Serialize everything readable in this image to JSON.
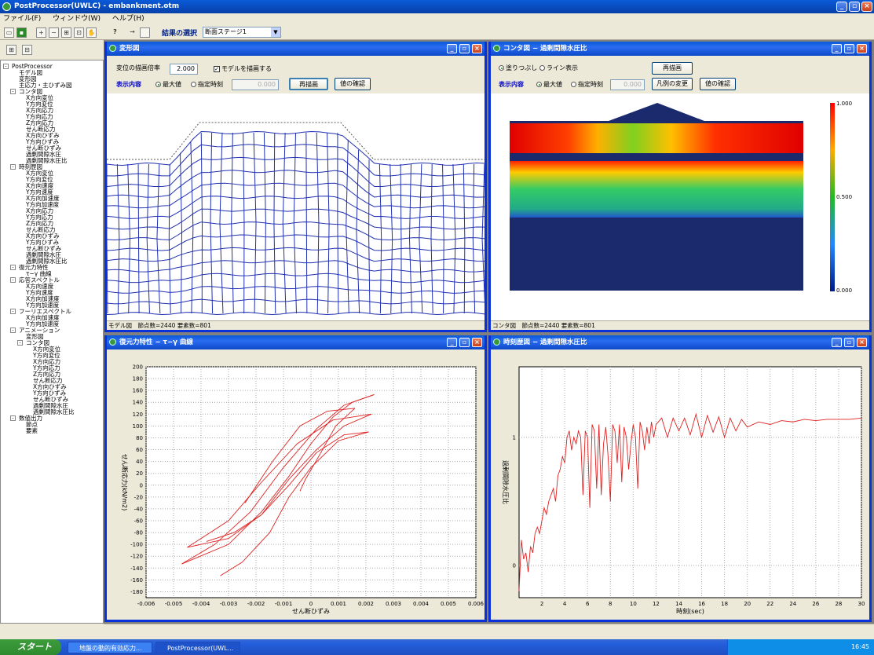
{
  "app": {
    "title": "PostProcessor(UWLC) - embankment.otm"
  },
  "menu": {
    "items": [
      "ファイル(F)",
      "ウィンドウ(W)",
      "ヘルプ(H)"
    ]
  },
  "toolbar": {
    "stage_label": "結果の選択",
    "stage_value": "断面ステージ1"
  },
  "tree": {
    "nodes": [
      {
        "label": "PostProcessor",
        "level": 0,
        "box": "-"
      },
      {
        "label": "モデル図",
        "level": 1
      },
      {
        "label": "変形図",
        "level": 1
      },
      {
        "label": "主応力・主ひずみ図",
        "level": 1
      },
      {
        "label": "コンタ図",
        "level": 1,
        "box": "-"
      },
      {
        "label": "X方向変位",
        "level": 2
      },
      {
        "label": "Y方向変位",
        "level": 2
      },
      {
        "label": "X方向応力",
        "level": 2
      },
      {
        "label": "Y方向応力",
        "level": 2
      },
      {
        "label": "Z方向応力",
        "level": 2
      },
      {
        "label": "せん断応力",
        "level": 2
      },
      {
        "label": "X方向ひずみ",
        "level": 2
      },
      {
        "label": "Y方向ひずみ",
        "level": 2
      },
      {
        "label": "せん断ひずみ",
        "level": 2
      },
      {
        "label": "過剰間隙水圧",
        "level": 2
      },
      {
        "label": "過剰間隙水圧比",
        "level": 2
      },
      {
        "label": "時刻歴図",
        "level": 1,
        "box": "-"
      },
      {
        "label": "X方向変位",
        "level": 2
      },
      {
        "label": "Y方向変位",
        "level": 2
      },
      {
        "label": "X方向速度",
        "level": 2
      },
      {
        "label": "Y方向速度",
        "level": 2
      },
      {
        "label": "X方向加速度",
        "level": 2
      },
      {
        "label": "Y方向加速度",
        "level": 2
      },
      {
        "label": "X方向応力",
        "level": 2
      },
      {
        "label": "Y方向応力",
        "level": 2
      },
      {
        "label": "Z方向応力",
        "level": 2
      },
      {
        "label": "せん断応力",
        "level": 2
      },
      {
        "label": "X方向ひずみ",
        "level": 2
      },
      {
        "label": "Y方向ひずみ",
        "level": 2
      },
      {
        "label": "せん断ひずみ",
        "level": 2
      },
      {
        "label": "過剰間隙水圧",
        "level": 2
      },
      {
        "label": "過剰間隙水圧比",
        "level": 2
      },
      {
        "label": "復元力特性",
        "level": 1,
        "box": "-"
      },
      {
        "label": "τ−γ 曲線",
        "level": 2
      },
      {
        "label": "応答スペクトル",
        "level": 1,
        "box": "-"
      },
      {
        "label": "X方向速度",
        "level": 2
      },
      {
        "label": "Y方向速度",
        "level": 2
      },
      {
        "label": "X方向加速度",
        "level": 2
      },
      {
        "label": "Y方向加速度",
        "level": 2
      },
      {
        "label": "フーリエスペクトル",
        "level": 1,
        "box": "-"
      },
      {
        "label": "X方向加速度",
        "level": 2
      },
      {
        "label": "Y方向加速度",
        "level": 2
      },
      {
        "label": "アニメーション",
        "level": 1,
        "box": "-"
      },
      {
        "label": "変形図",
        "level": 2
      },
      {
        "label": "コンタ図",
        "level": 2,
        "box": "-"
      },
      {
        "label": "X方向変位",
        "level": 3
      },
      {
        "label": "Y方向変位",
        "level": 3
      },
      {
        "label": "X方向応力",
        "level": 3
      },
      {
        "label": "Y方向応力",
        "level": 3
      },
      {
        "label": "Z方向応力",
        "level": 3
      },
      {
        "label": "せん断応力",
        "level": 3
      },
      {
        "label": "X方向ひずみ",
        "level": 3
      },
      {
        "label": "Y方向ひずみ",
        "level": 3
      },
      {
        "label": "せん断ひずみ",
        "level": 3
      },
      {
        "label": "過剰間隙水圧",
        "level": 3
      },
      {
        "label": "過剰間隙水圧比",
        "level": 3
      },
      {
        "label": "数値出力",
        "level": 1,
        "box": "-"
      },
      {
        "label": "節点",
        "level": 2
      },
      {
        "label": "要素",
        "level": 2
      }
    ]
  },
  "win_deform": {
    "title": "変形図",
    "scale_label": "変位の描画倍率",
    "scale_value": "2.000",
    "model_check_label": "モデルを描画する",
    "display_label": "表示内容",
    "radio_max": "最大値",
    "radio_time": "指定時刻",
    "time_value": "0.000",
    "redraw_label": "再描画",
    "confirm_label": "値の確認",
    "status": "モデル図　節点数=2440 要素数=801"
  },
  "win_contour": {
    "title": "コンタ図 − 過剰間隙水圧比",
    "radio_fill": "塗りつぶし",
    "radio_line": "ライン表示",
    "redraw_label": "再描画",
    "display_label": "表示内容",
    "radio_max": "最大値",
    "radio_time": "指定時刻",
    "time_value": "0.000",
    "legend_change_label": "凡例の変更",
    "confirm_label": "値の確認",
    "legend": [
      "1.000",
      "0.500",
      "0.000"
    ],
    "status": "コンタ図　節点数=2440 要素数=801"
  },
  "win_hyst": {
    "title": "復元力特性 − τ−γ 曲線",
    "chart_data": {
      "type": "line",
      "xlabel": "せん断ひずみ",
      "ylabel": "せん断応力(kN/m2)",
      "xlim": [
        -0.006,
        0.006
      ],
      "ylim": [
        -190,
        200
      ],
      "xticks": [
        "-0.006",
        "-0.005",
        "-0.004",
        "-0.003",
        "-0.002",
        "-0.001",
        "0",
        "0.001",
        "0.002",
        "0.003",
        "0.004",
        "0.005",
        "0.006"
      ],
      "yticks": [
        "200",
        "180",
        "160",
        "140",
        "120",
        "100",
        "80",
        "60",
        "40",
        "20",
        "0",
        "-20",
        "-40",
        "-60",
        "-80",
        "-100",
        "-120",
        "-140",
        "-160",
        "-180"
      ],
      "grid": true,
      "series": [
        {
          "x": [
            -0.0047,
            -0.003,
            -0.0018,
            -0.0008,
            0.0,
            0.0008,
            0.0015,
            0.0023
          ],
          "y": [
            -133,
            -100,
            -45,
            15,
            70,
            115,
            140,
            153
          ]
        },
        {
          "x": [
            0.0023,
            0.0012,
            0.0002,
            -0.001,
            -0.0022,
            -0.0035,
            -0.0047
          ],
          "y": [
            153,
            135,
            95,
            30,
            -45,
            -100,
            -133
          ]
        },
        {
          "x": [
            -0.0045,
            -0.003,
            -0.0018,
            -0.0008,
            0.0002,
            0.0012,
            0.0022
          ],
          "y": [
            -105,
            -90,
            -50,
            10,
            60,
            100,
            120
          ]
        },
        {
          "x": [
            0.0022,
            0.0008,
            -0.0005,
            -0.0018,
            -0.003,
            -0.0045
          ],
          "y": [
            120,
            110,
            70,
            5,
            -60,
            -105
          ]
        },
        {
          "x": [
            -0.0033,
            -0.0025,
            -0.0015,
            -0.0008,
            0.0,
            0.001,
            0.0021
          ],
          "y": [
            -153,
            -130,
            -80,
            -20,
            30,
            75,
            90
          ]
        },
        {
          "x": [
            0.0021,
            0.0012,
            0.0002,
            -0.0008,
            -0.0018,
            -0.0028,
            -0.0038
          ],
          "y": [
            90,
            85,
            55,
            0,
            -50,
            -80,
            -95
          ]
        },
        {
          "x": [
            -0.0004,
            -0.0002,
            0.0003,
            0.0009,
            0.0016
          ],
          "y": [
            -10,
            10,
            50,
            100,
            130
          ]
        },
        {
          "x": [
            0.0016,
            0.0006,
            -0.0004,
            -0.0014,
            -0.0024
          ],
          "y": [
            130,
            125,
            100,
            40,
            -30
          ]
        }
      ]
    }
  },
  "win_time": {
    "title": "時刻歴図 − 過剰間隙水圧比",
    "chart_data": {
      "type": "line",
      "xlabel": "時刻(sec)",
      "ylabel": "過剰間隙水圧比",
      "xlim": [
        0,
        30
      ],
      "ylim": [
        -0.25,
        1.55
      ],
      "xticks": [
        "2",
        "4",
        "6",
        "8",
        "10",
        "12",
        "14",
        "16",
        "18",
        "20",
        "22",
        "24",
        "26",
        "28",
        "30"
      ],
      "yticks": [
        "1",
        "0"
      ],
      "grid": true,
      "series": [
        {
          "name": "",
          "x": [
            0,
            0.2,
            0.4,
            0.6,
            0.8,
            1,
            1.2,
            1.4,
            1.6,
            1.8,
            2,
            2.2,
            2.4,
            2.6,
            2.8,
            3,
            3.2,
            3.4,
            3.6,
            3.8,
            4,
            4.2,
            4.4,
            4.6,
            4.8,
            5,
            5.2,
            5.4,
            5.6,
            5.8,
            6,
            6.2,
            6.4,
            6.6,
            6.8,
            7,
            7.2,
            7.4,
            7.6,
            7.8,
            8,
            8.2,
            8.4,
            8.6,
            8.8,
            9,
            9.2,
            9.4,
            9.6,
            9.8,
            10,
            10.2,
            10.4,
            10.6,
            10.8,
            11,
            11.2,
            11.4,
            11.6,
            11.8,
            12,
            12.5,
            13,
            13.5,
            14,
            14.5,
            15,
            15.5,
            16,
            16.5,
            17,
            17.5,
            18,
            18.5,
            19,
            19.5,
            20,
            21,
            22,
            23,
            24,
            25,
            26,
            27,
            28,
            29,
            30
          ],
          "y": [
            -0.2,
            0.2,
            0.05,
            0.1,
            -0.05,
            0.15,
            0.1,
            0.25,
            0.3,
            0.25,
            0.35,
            0.45,
            0.4,
            0.5,
            0.55,
            0.6,
            0.5,
            0.7,
            0.75,
            0.85,
            0.8,
            1.0,
            1.05,
            0.9,
            1.0,
            0.95,
            1.05,
            1.0,
            0.55,
            1.05,
            1.0,
            0.45,
            1.1,
            1.05,
            0.6,
            1.1,
            0.55,
            0.95,
            1.08,
            0.85,
            0.5,
            1.1,
            1.05,
            0.8,
            1.1,
            0.65,
            1.08,
            1.0,
            0.75,
            0.95,
            1.1,
            1.0,
            0.6,
            1.12,
            1.05,
            0.9,
            1.08,
            0.95,
            1.12,
            1.0,
            1.1,
            1.15,
            1.0,
            1.15,
            1.05,
            1.15,
            1.02,
            1.18,
            1.0,
            1.17,
            1.04,
            1.16,
            1.0,
            1.15,
            1.05,
            1.14,
            1.08,
            1.12,
            1.1,
            1.13,
            1.12,
            1.14,
            1.13,
            1.14,
            1.14,
            1.14,
            1.15
          ]
        }
      ]
    }
  },
  "taskbar": {
    "start": "スタート",
    "tasks": [
      "地盤の動的有効応力...",
      "PostProcessor(UWL..."
    ],
    "clock": "16:45"
  }
}
